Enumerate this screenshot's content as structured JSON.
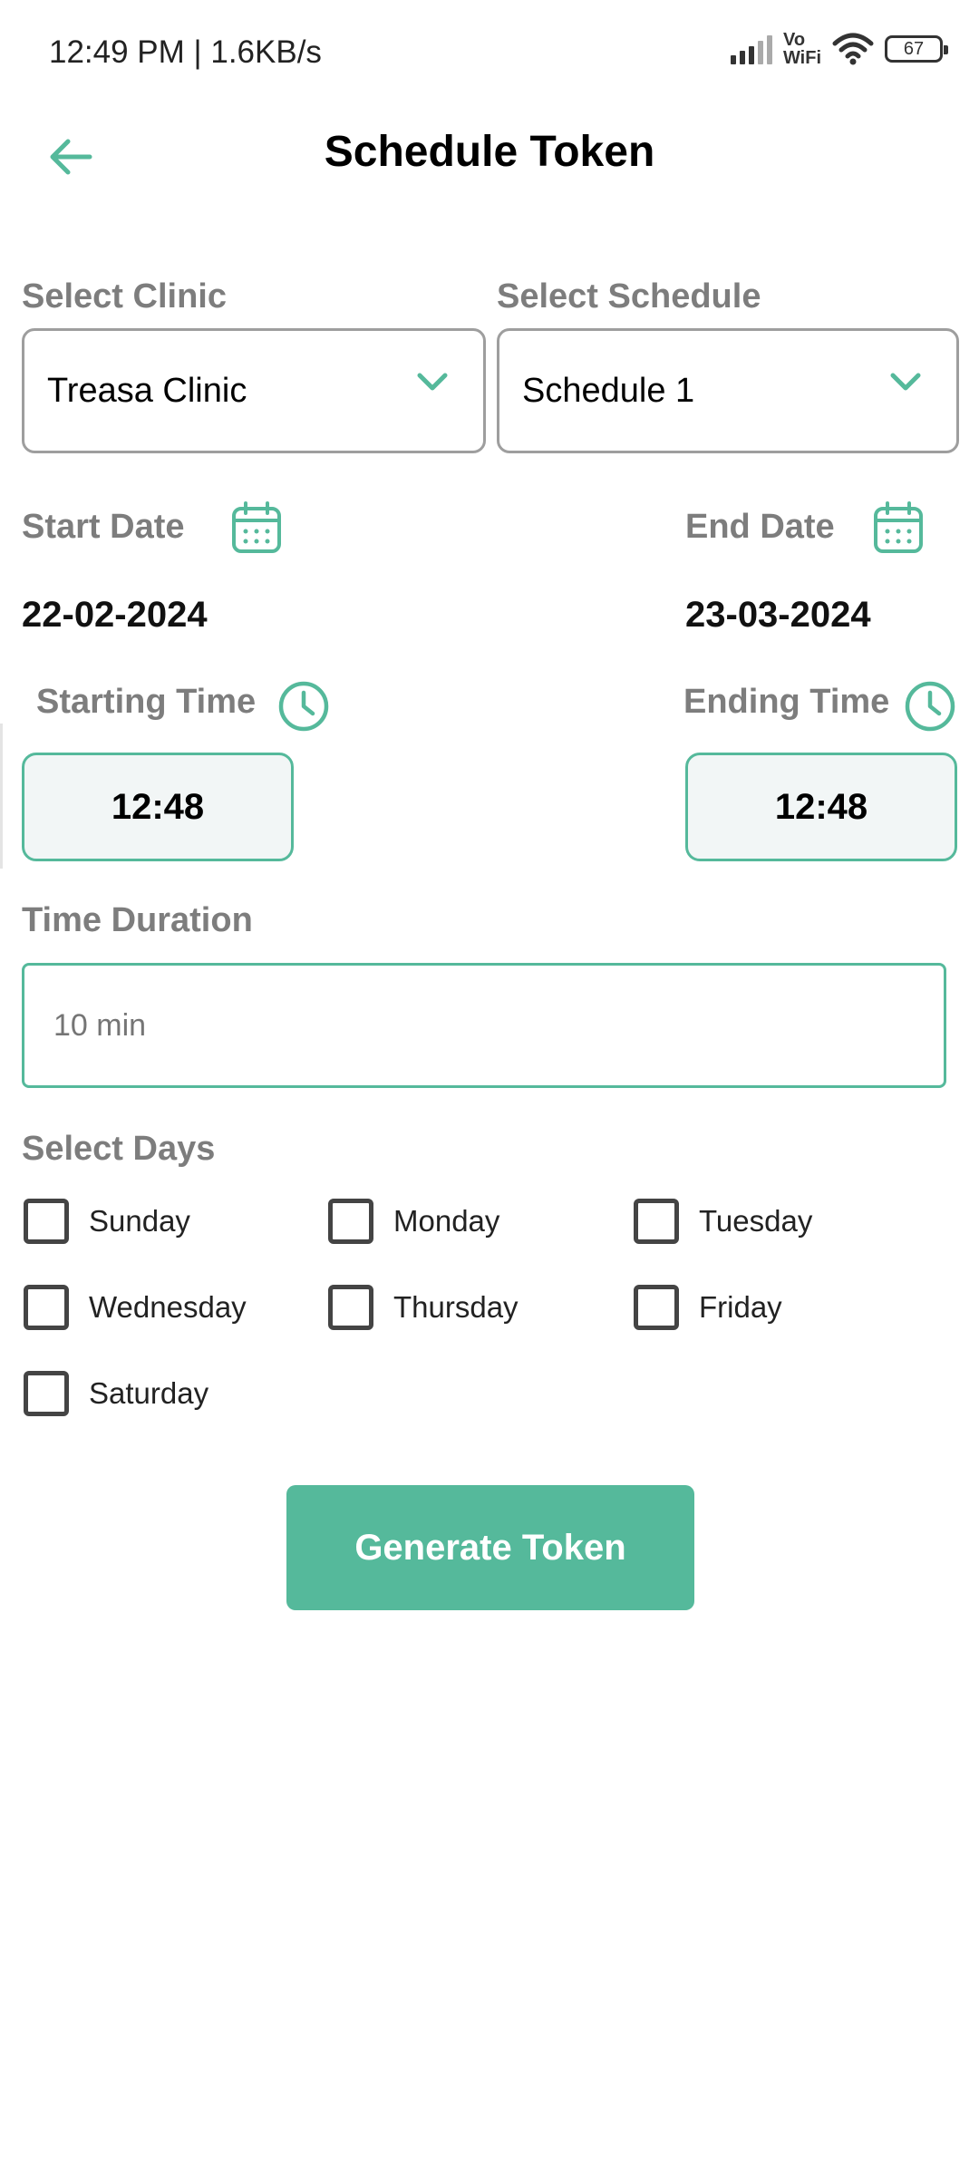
{
  "status_bar": {
    "time": "12:49 PM | 1.6KB/s",
    "network_label": "Vo\nWiFi",
    "battery": "67"
  },
  "header": {
    "title": "Schedule Token",
    "back_icon": "arrow-left-icon"
  },
  "form": {
    "clinic": {
      "label": "Select Clinic",
      "value": "Treasa Clinic"
    },
    "schedule": {
      "label": "Select Schedule",
      "value": "Schedule 1"
    },
    "start_date": {
      "label": "Start Date",
      "value": "22-02-2024"
    },
    "end_date": {
      "label": "End Date",
      "value": "23-03-2024"
    },
    "starting_time": {
      "label": "Starting Time",
      "value": "12:48"
    },
    "ending_time": {
      "label": "Ending Time",
      "value": "12:48"
    },
    "duration": {
      "label": "Time Duration",
      "placeholder": "10 min"
    },
    "days": {
      "label": "Select Days",
      "items": [
        "Sunday",
        "Monday",
        "Tuesday",
        "Wednesday",
        "Thursday",
        "Friday",
        "Saturday"
      ]
    },
    "submit_label": "Generate Token"
  },
  "colors": {
    "accent": "#55b99b",
    "label_gray": "#7d7d7d",
    "time_box_bg": "#f2f6f6"
  }
}
